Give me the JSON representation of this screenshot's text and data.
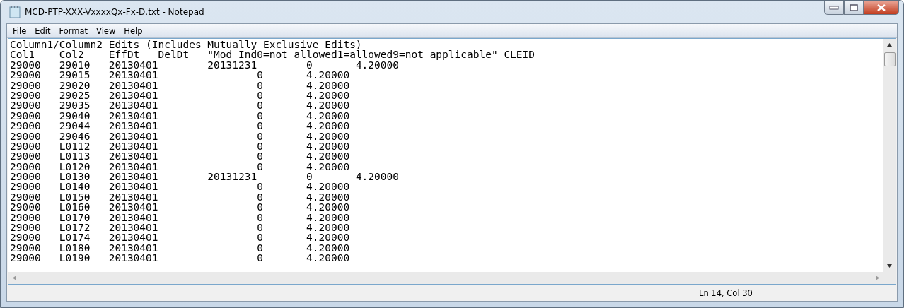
{
  "window": {
    "title": "MCD-PTP-XXX-VxxxxQx-Fx-D.txt - Notepad"
  },
  "menu": [
    "File",
    "Edit",
    "Format",
    "View",
    "Help"
  ],
  "document": {
    "lines": [
      "Column1/Column2 Edits (Includes Mutually Exclusive Edits)",
      "Col1\tCol2\tEffDt\tDelDt\t\"Mod Ind0=not allowed1=allowed9=not applicable\" CLEID",
      "29000\t29010\t20130401\t20131231\t0\t4.20000",
      "29000\t29015\t20130401\t\t0\t4.20000",
      "29000\t29020\t20130401\t\t0\t4.20000",
      "29000\t29025\t20130401\t\t0\t4.20000",
      "29000\t29035\t20130401\t\t0\t4.20000",
      "29000\t29040\t20130401\t\t0\t4.20000",
      "29000\t29044\t20130401\t\t0\t4.20000",
      "29000\t29046\t20130401\t\t0\t4.20000",
      "29000\tL0112\t20130401\t\t0\t4.20000",
      "29000\tL0113\t20130401\t\t0\t4.20000",
      "29000\tL0120\t20130401\t\t0\t4.20000",
      "29000\tL0130\t20130401\t20131231\t0\t4.20000",
      "29000\tL0140\t20130401\t\t0\t4.20000",
      "29000\tL0150\t20130401\t\t0\t4.20000",
      "29000\tL0160\t20130401\t\t0\t4.20000",
      "29000\tL0170\t20130401\t\t0\t4.20000",
      "29000\tL0172\t20130401\t\t0\t4.20000",
      "29000\tL0174\t20130401\t\t0\t4.20000",
      "29000\tL0180\t20130401\t\t0\t4.20000",
      "29000\tL0190\t20130401\t\t0\t4.20000"
    ]
  },
  "status_bar": {
    "position": "Ln 14, Col 30"
  }
}
